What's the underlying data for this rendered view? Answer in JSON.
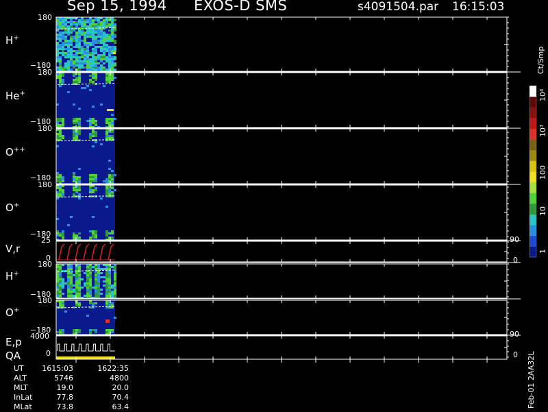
{
  "header": {
    "date": "Sep 15, 1994",
    "instrument": "EXOS-D SMS",
    "file": "s4091504.par",
    "time": "16:15:03"
  },
  "panels": [
    {
      "label": "H",
      "sup": "+",
      "ymax": "180",
      "ymin": "−180"
    },
    {
      "label": "He",
      "sup": "+",
      "ymax": "180",
      "ymin": "−180"
    },
    {
      "label": "O",
      "sup": "++",
      "ymax": "180",
      "ymin": "−180"
    },
    {
      "label": "O",
      "sup": "+",
      "ymax": "180",
      "ymin": "−180"
    },
    {
      "label": "V,r",
      "sup": "",
      "ymax": "25",
      "ymin": "0",
      "rmax": "90",
      "rmin": "0"
    },
    {
      "label": "H",
      "sup": "+",
      "ymax": "180",
      "ymin": "−180"
    },
    {
      "label": "O",
      "sup": "+",
      "ymax": "180",
      "ymin": "−180"
    },
    {
      "label": "E,p",
      "label2": "QA",
      "sup": "",
      "ymax": "4000",
      "ymin": "0",
      "rmax": "90",
      "rmin": "0"
    }
  ],
  "colorbar": {
    "unit": "Ct/Smp",
    "ticks": [
      "1",
      "10",
      "100",
      "10³",
      "10⁴"
    ],
    "colors": [
      "#0a1a8c",
      "#1e4bd2",
      "#2a8fe0",
      "#28c4c8",
      "#2f9a3c",
      "#4fd23a",
      "#a8e040",
      "#f0e020",
      "#d8c410",
      "#9a8a10",
      "#7a6010",
      "#e0302a",
      "#c01818",
      "#8a1010",
      "#600808",
      "#ffffff"
    ]
  },
  "footer": {
    "rows": [
      {
        "label": "UT",
        "v1": "1615:03",
        "v2": "1622:35"
      },
      {
        "label": "ALT",
        "v1": "5746",
        "v2": "4800"
      },
      {
        "label": "MLT",
        "v1": "19.0",
        "v2": "20.0"
      },
      {
        "label": "InLat",
        "v1": "77.8",
        "v2": "70.4"
      },
      {
        "label": "MLat",
        "v1": "73.8",
        "v2": "63.4"
      }
    ]
  },
  "stamp": "Feb-01 2AA32L",
  "chart_data": {
    "type": "heatmap",
    "title": "Sep 15, 1994   EXOS-D SMS",
    "panels": [
      "H+",
      "He+",
      "O++",
      "O+",
      "V,r",
      "H+",
      "O+",
      "E,p QA"
    ],
    "ut_range": [
      "1615:03",
      "1622:35"
    ],
    "pitch_angle_range": [
      -180,
      180
    ],
    "colorbar_range": [
      1,
      10000
    ],
    "colorbar_scale": "log",
    "colorbar_unit": "Ct/Smp"
  }
}
